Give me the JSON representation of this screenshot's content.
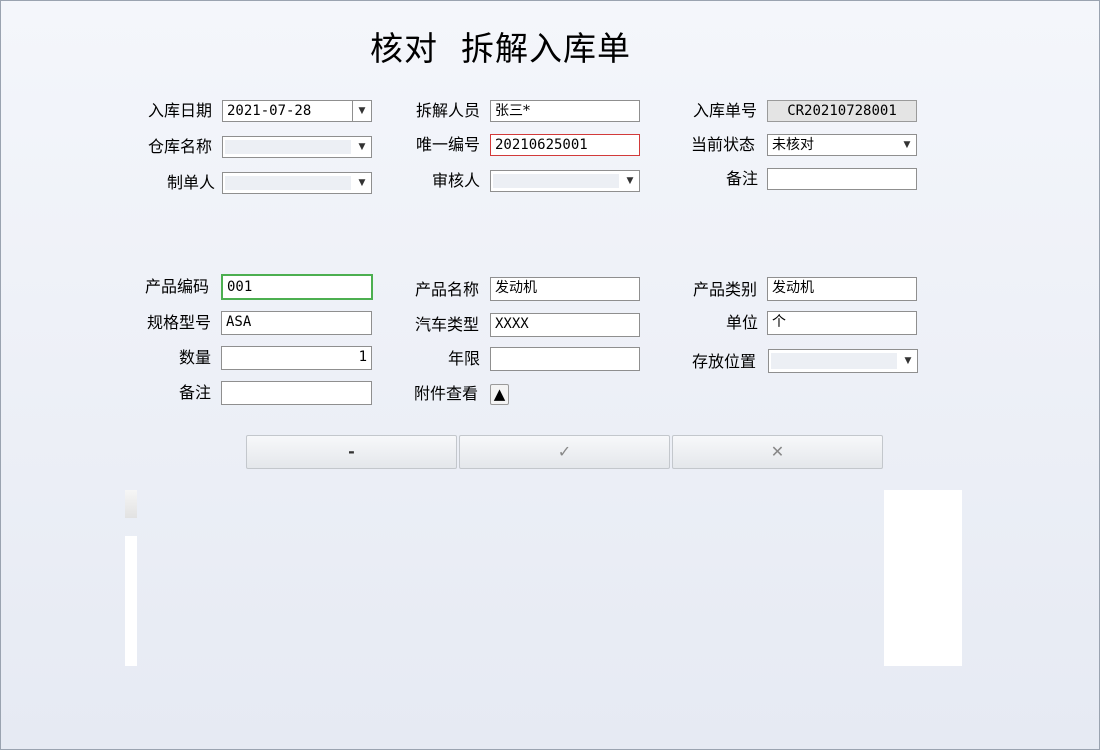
{
  "title": "核对  拆解入库单",
  "header": {
    "in_date_label": "入库日期",
    "in_date_value": "2021-07-28",
    "dismantler_label": "拆解人员",
    "dismantler_value": "张三*",
    "order_no_label": "入库单号",
    "order_no_value": "CR20210728001",
    "warehouse_label": "仓库名称",
    "unique_no_label": "唯一编号",
    "unique_no_value": "20210625001",
    "status_label": "当前状态",
    "status_value": "未核对",
    "creator_label": "制单人",
    "reviewer_label": "审核人",
    "remark_label": "备注",
    "remark_value": ""
  },
  "product": {
    "code_label": "产品编码",
    "code_value": "001",
    "name_label": "产品名称",
    "name_value": "发动机",
    "category_label": "产品类别",
    "category_value": "发动机",
    "spec_label": "规格型号",
    "spec_value": "ASA",
    "car_type_label": "汽车类型",
    "car_type_value": "XXXX",
    "unit_label": "单位",
    "unit_value": "个",
    "qty_label": "数量",
    "qty_value": "1",
    "years_label": "年限",
    "years_value": "",
    "location_label": "存放位置",
    "remark_label": "备注",
    "remark_value": "",
    "attachment_label": "附件查看",
    "attachment_icon": "▲"
  },
  "actions": {
    "minus": "-",
    "confirm": "✓",
    "cancel": "✕"
  },
  "icons": {
    "dropdown": "▼"
  }
}
